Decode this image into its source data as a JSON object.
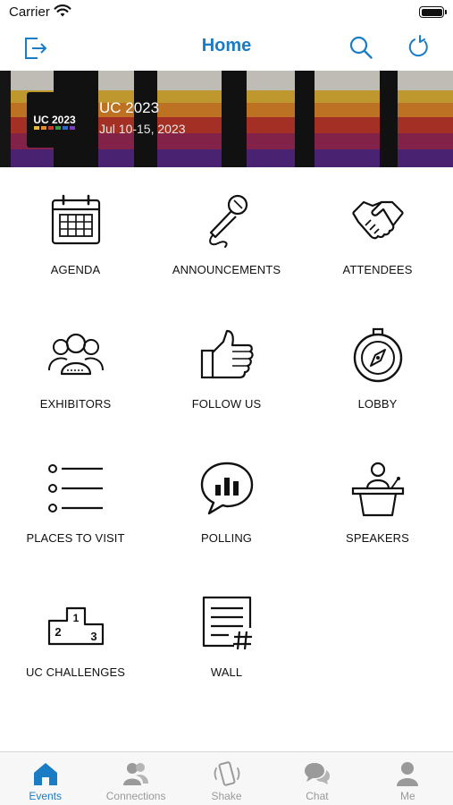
{
  "status_bar": {
    "carrier": "Carrier"
  },
  "nav": {
    "title": "Home"
  },
  "event": {
    "title": "UC 2023",
    "dates": "Jul 10-15, 2023",
    "logo_text": "UC 2023"
  },
  "menu": [
    {
      "label": "AGENDA",
      "icon": "calendar-icon"
    },
    {
      "label": "ANNOUNCEMENTS",
      "icon": "microphone-icon"
    },
    {
      "label": "ATTENDEES",
      "icon": "handshake-icon"
    },
    {
      "label": "EXHIBITORS",
      "icon": "group-icon"
    },
    {
      "label": "FOLLOW US",
      "icon": "thumbs-up-icon"
    },
    {
      "label": "LOBBY",
      "icon": "compass-icon"
    },
    {
      "label": "PLACES TO VISIT",
      "icon": "list-icon"
    },
    {
      "label": "POLLING",
      "icon": "poll-icon"
    },
    {
      "label": "SPEAKERS",
      "icon": "podium-icon"
    },
    {
      "label": "UC CHALLENGES",
      "icon": "leaderboard-podium-icon"
    },
    {
      "label": "WALL",
      "icon": "wall-post-icon"
    }
  ],
  "tabs": [
    {
      "label": "Events",
      "icon": "home-icon",
      "active": true
    },
    {
      "label": "Connections",
      "icon": "people-icon",
      "active": false
    },
    {
      "label": "Shake",
      "icon": "phone-shake-icon",
      "active": false
    },
    {
      "label": "Chat",
      "icon": "chat-bubbles-icon",
      "active": false
    },
    {
      "label": "Me",
      "icon": "person-icon",
      "active": false
    }
  ],
  "colors": {
    "accent": "#1a7cc4",
    "inactive": "#9a9a9a",
    "tab_bar_bg": "#f7f7f7"
  }
}
